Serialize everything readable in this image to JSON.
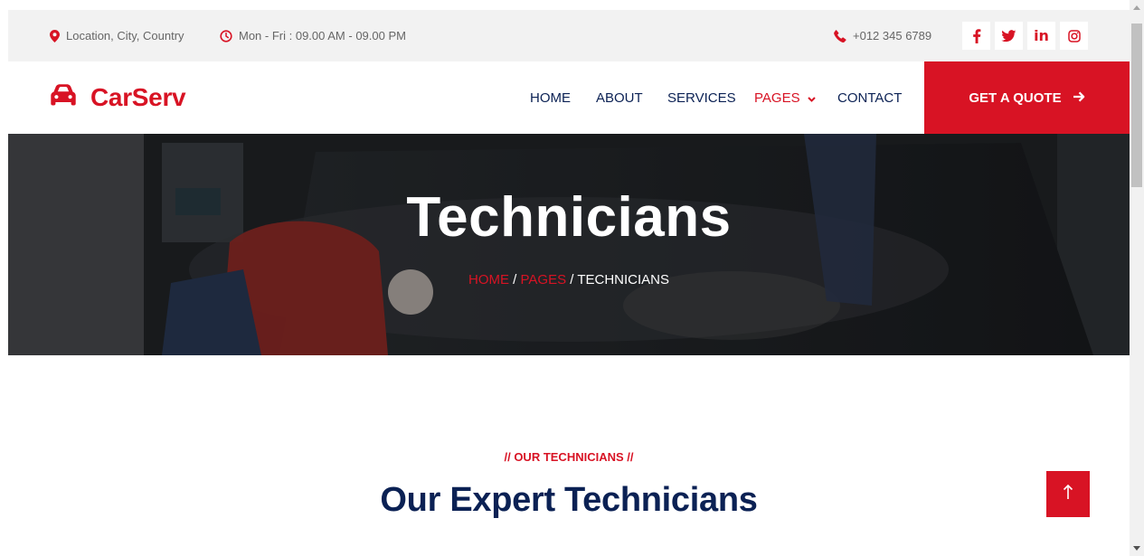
{
  "topbar": {
    "location": "Location, City, Country",
    "hours": "Mon - Fri : 09.00 AM - 09.00 PM",
    "phone": "+012 345 6789",
    "social": [
      "facebook-icon",
      "twitter-icon",
      "linkedin-icon",
      "instagram-icon"
    ]
  },
  "nav": {
    "brand": "CarServ",
    "links": [
      "HOME",
      "ABOUT",
      "SERVICES",
      "PAGES",
      "CONTACT"
    ],
    "active": "PAGES",
    "quote_label": "GET A QUOTE"
  },
  "hero": {
    "title": "Technicians",
    "breadcrumb": {
      "home": "HOME",
      "sep1": "/",
      "pages": "PAGES",
      "sep2": "/",
      "current": "TECHNICIANS"
    }
  },
  "section": {
    "subtitle": "// OUR TECHNICIANS //",
    "title": "Our Expert Technicians"
  },
  "colors": {
    "primary": "#D81324",
    "dark": "#0B2154",
    "topbar_bg": "#F2F2F2"
  }
}
